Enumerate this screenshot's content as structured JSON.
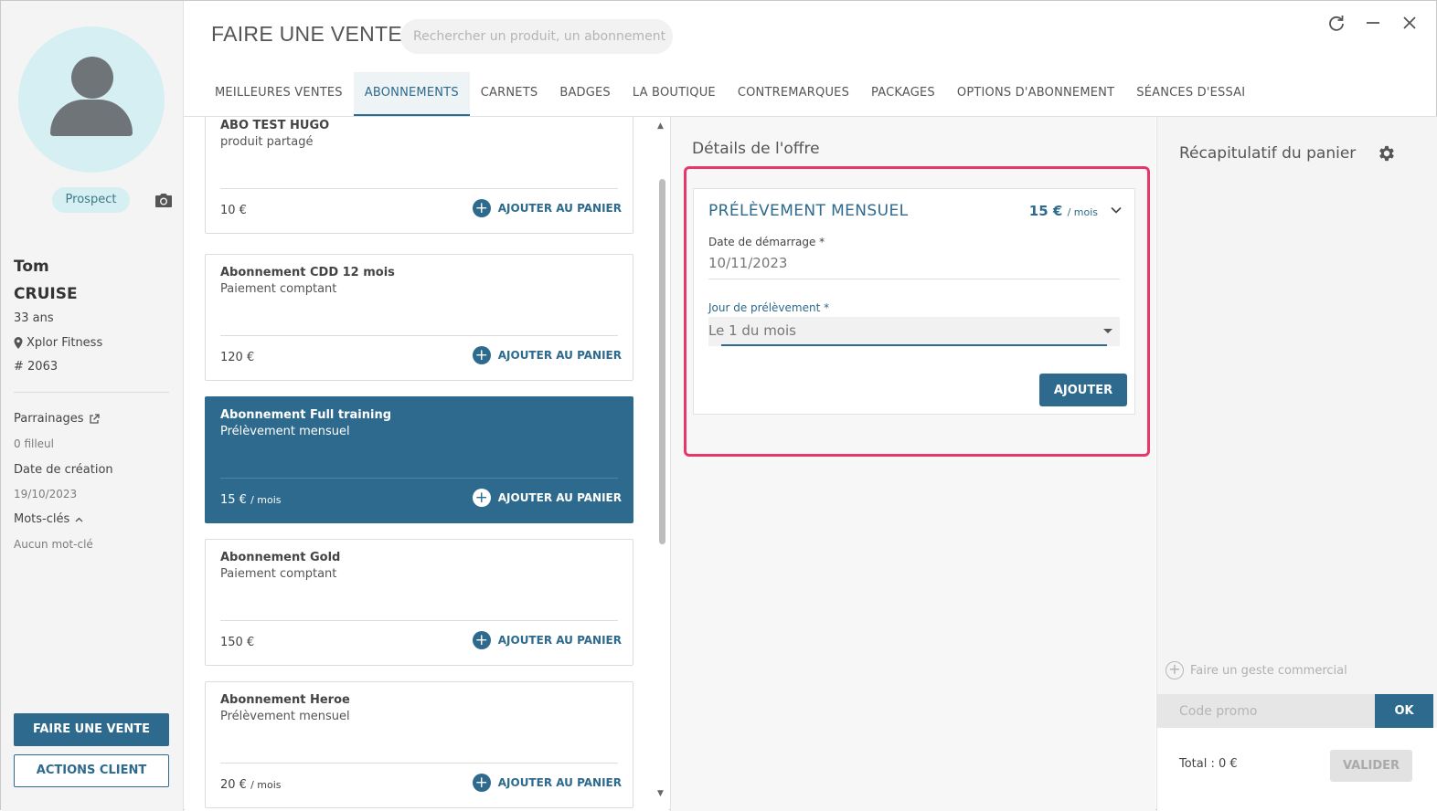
{
  "client": {
    "status_badge": "Prospect",
    "first_name": "Tom",
    "last_name": "CRUISE",
    "age": "33 ans",
    "club": "Xplor Fitness",
    "member_number": "# 2063",
    "referrals_label": "Parrainages",
    "referrals_value": "0 filleul",
    "creation_label": "Date de création",
    "creation_value": "19/10/2023",
    "keywords_label": "Mots-clés",
    "keywords_value": "Aucun mot-clé",
    "sale_button": "FAIRE UNE VENTE",
    "actions_button": "ACTIONS CLIENT"
  },
  "header": {
    "title": "FAIRE UNE VENTE",
    "search_placeholder": "Rechercher un produit, un abonnement"
  },
  "tabs": [
    {
      "label": "MEILLEURES VENTES",
      "active": false
    },
    {
      "label": "ABONNEMENTS",
      "active": true
    },
    {
      "label": "CARNETS",
      "active": false
    },
    {
      "label": "BADGES",
      "active": false
    },
    {
      "label": "LA BOUTIQUE",
      "active": false
    },
    {
      "label": "CONTREMARQUES",
      "active": false
    },
    {
      "label": "PACKAGES",
      "active": false
    },
    {
      "label": "OPTIONS D'ABONNEMENT",
      "active": false
    },
    {
      "label": "SÉANCES D'ESSAI",
      "active": false
    }
  ],
  "products": [
    {
      "name": "ABO TEST HUGO",
      "subtitle": "produit partagé",
      "price": "10 €",
      "unit": "",
      "add_label": "AJOUTER AU PANIER",
      "selected": false
    },
    {
      "name": "Abonnement CDD 12 mois",
      "subtitle": "Paiement comptant",
      "price": "120 €",
      "unit": "",
      "add_label": "AJOUTER AU PANIER",
      "selected": false
    },
    {
      "name": "Abonnement Full training",
      "subtitle": "Prélèvement mensuel",
      "price": "15 €",
      "unit": "/ mois",
      "add_label": "AJOUTER AU PANIER",
      "selected": true
    },
    {
      "name": "Abonnement Gold",
      "subtitle": "Paiement comptant",
      "price": "150 €",
      "unit": "",
      "add_label": "AJOUTER AU PANIER",
      "selected": false
    },
    {
      "name": "Abonnement Heroe",
      "subtitle": "Prélèvement mensuel",
      "price": "20 €",
      "unit": "/ mois",
      "add_label": "AJOUTER AU PANIER",
      "selected": false
    }
  ],
  "offer": {
    "section_title": "Détails de l'offre",
    "title": "PRÉLÈVEMENT MENSUEL",
    "price": "15 €",
    "unit": "/ mois",
    "start_date_label": "Date de démarrage *",
    "start_date_value": "10/11/2023",
    "debit_day_label": "Jour de prélèvement *",
    "debit_day_value": "Le 1 du mois",
    "add_button": "AJOUTER",
    "highlight_color": "#e8376a"
  },
  "cart": {
    "title": "Récapitulatif du panier",
    "commercial_gesture": "Faire un geste commercial",
    "promo_placeholder": "Code promo",
    "ok_button": "OK",
    "total": "Total : 0 €",
    "validate_button": "VALIDER"
  },
  "colors": {
    "primary": "#2d6a8d",
    "avatar_bg": "#d5eff2"
  }
}
